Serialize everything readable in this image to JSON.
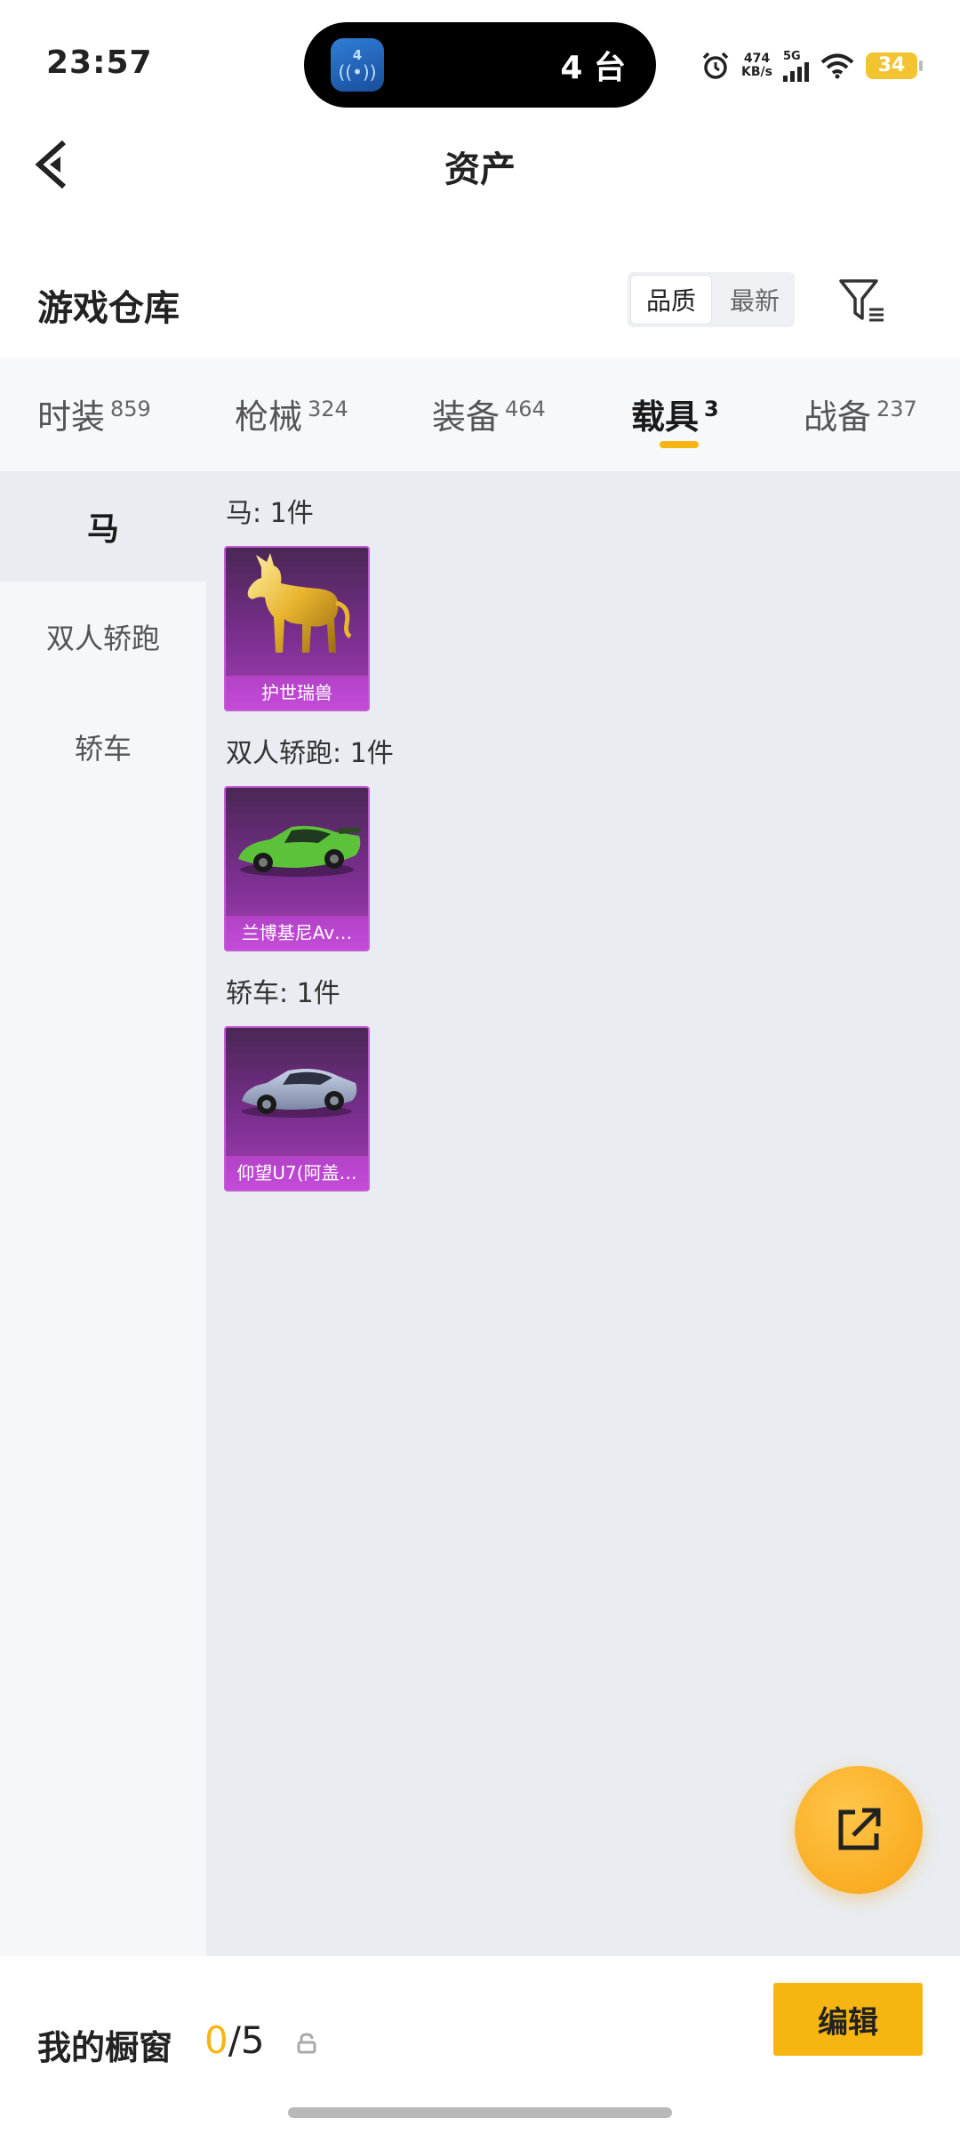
{
  "status_bar": {
    "time": "23:57",
    "island_app_badge": "4",
    "island_text": "4 台",
    "net_speed_value": "474",
    "net_speed_unit": "KB/s",
    "network_type": "5G",
    "battery": "34"
  },
  "header": {
    "title": "资产"
  },
  "section": {
    "title": "游戏仓库",
    "sort_options": [
      "品质",
      "最新"
    ],
    "active_sort": "品质"
  },
  "tabs": [
    {
      "label": "时装",
      "count": "859"
    },
    {
      "label": "枪械",
      "count": "324"
    },
    {
      "label": "装备",
      "count": "464"
    },
    {
      "label": "载具",
      "count": "3"
    },
    {
      "label": "战备",
      "count": "237"
    }
  ],
  "active_tab": "载具",
  "sidebar": {
    "items": [
      {
        "label": "马"
      },
      {
        "label": "双人轿跑"
      },
      {
        "label": "轿车"
      }
    ],
    "active": "马"
  },
  "groups": [
    {
      "label": "马: 1件",
      "items": [
        {
          "name": "护世瑞兽",
          "icon": "golden-horse"
        }
      ]
    },
    {
      "label": "双人轿跑: 1件",
      "items": [
        {
          "name": "兰博基尼Av…",
          "icon": "green-sports-car"
        }
      ]
    },
    {
      "label": "轿车: 1件",
      "items": [
        {
          "name": "仰望U7(阿盖…",
          "icon": "silver-sedan"
        }
      ]
    }
  ],
  "bottom_bar": {
    "label": "我的橱窗",
    "count_current": "0",
    "count_total": "/5",
    "edit_label": "编辑"
  },
  "colors": {
    "accent": "#f7b512",
    "card_purple": "#a43fb6",
    "content_bg": "#e9ecf0"
  }
}
